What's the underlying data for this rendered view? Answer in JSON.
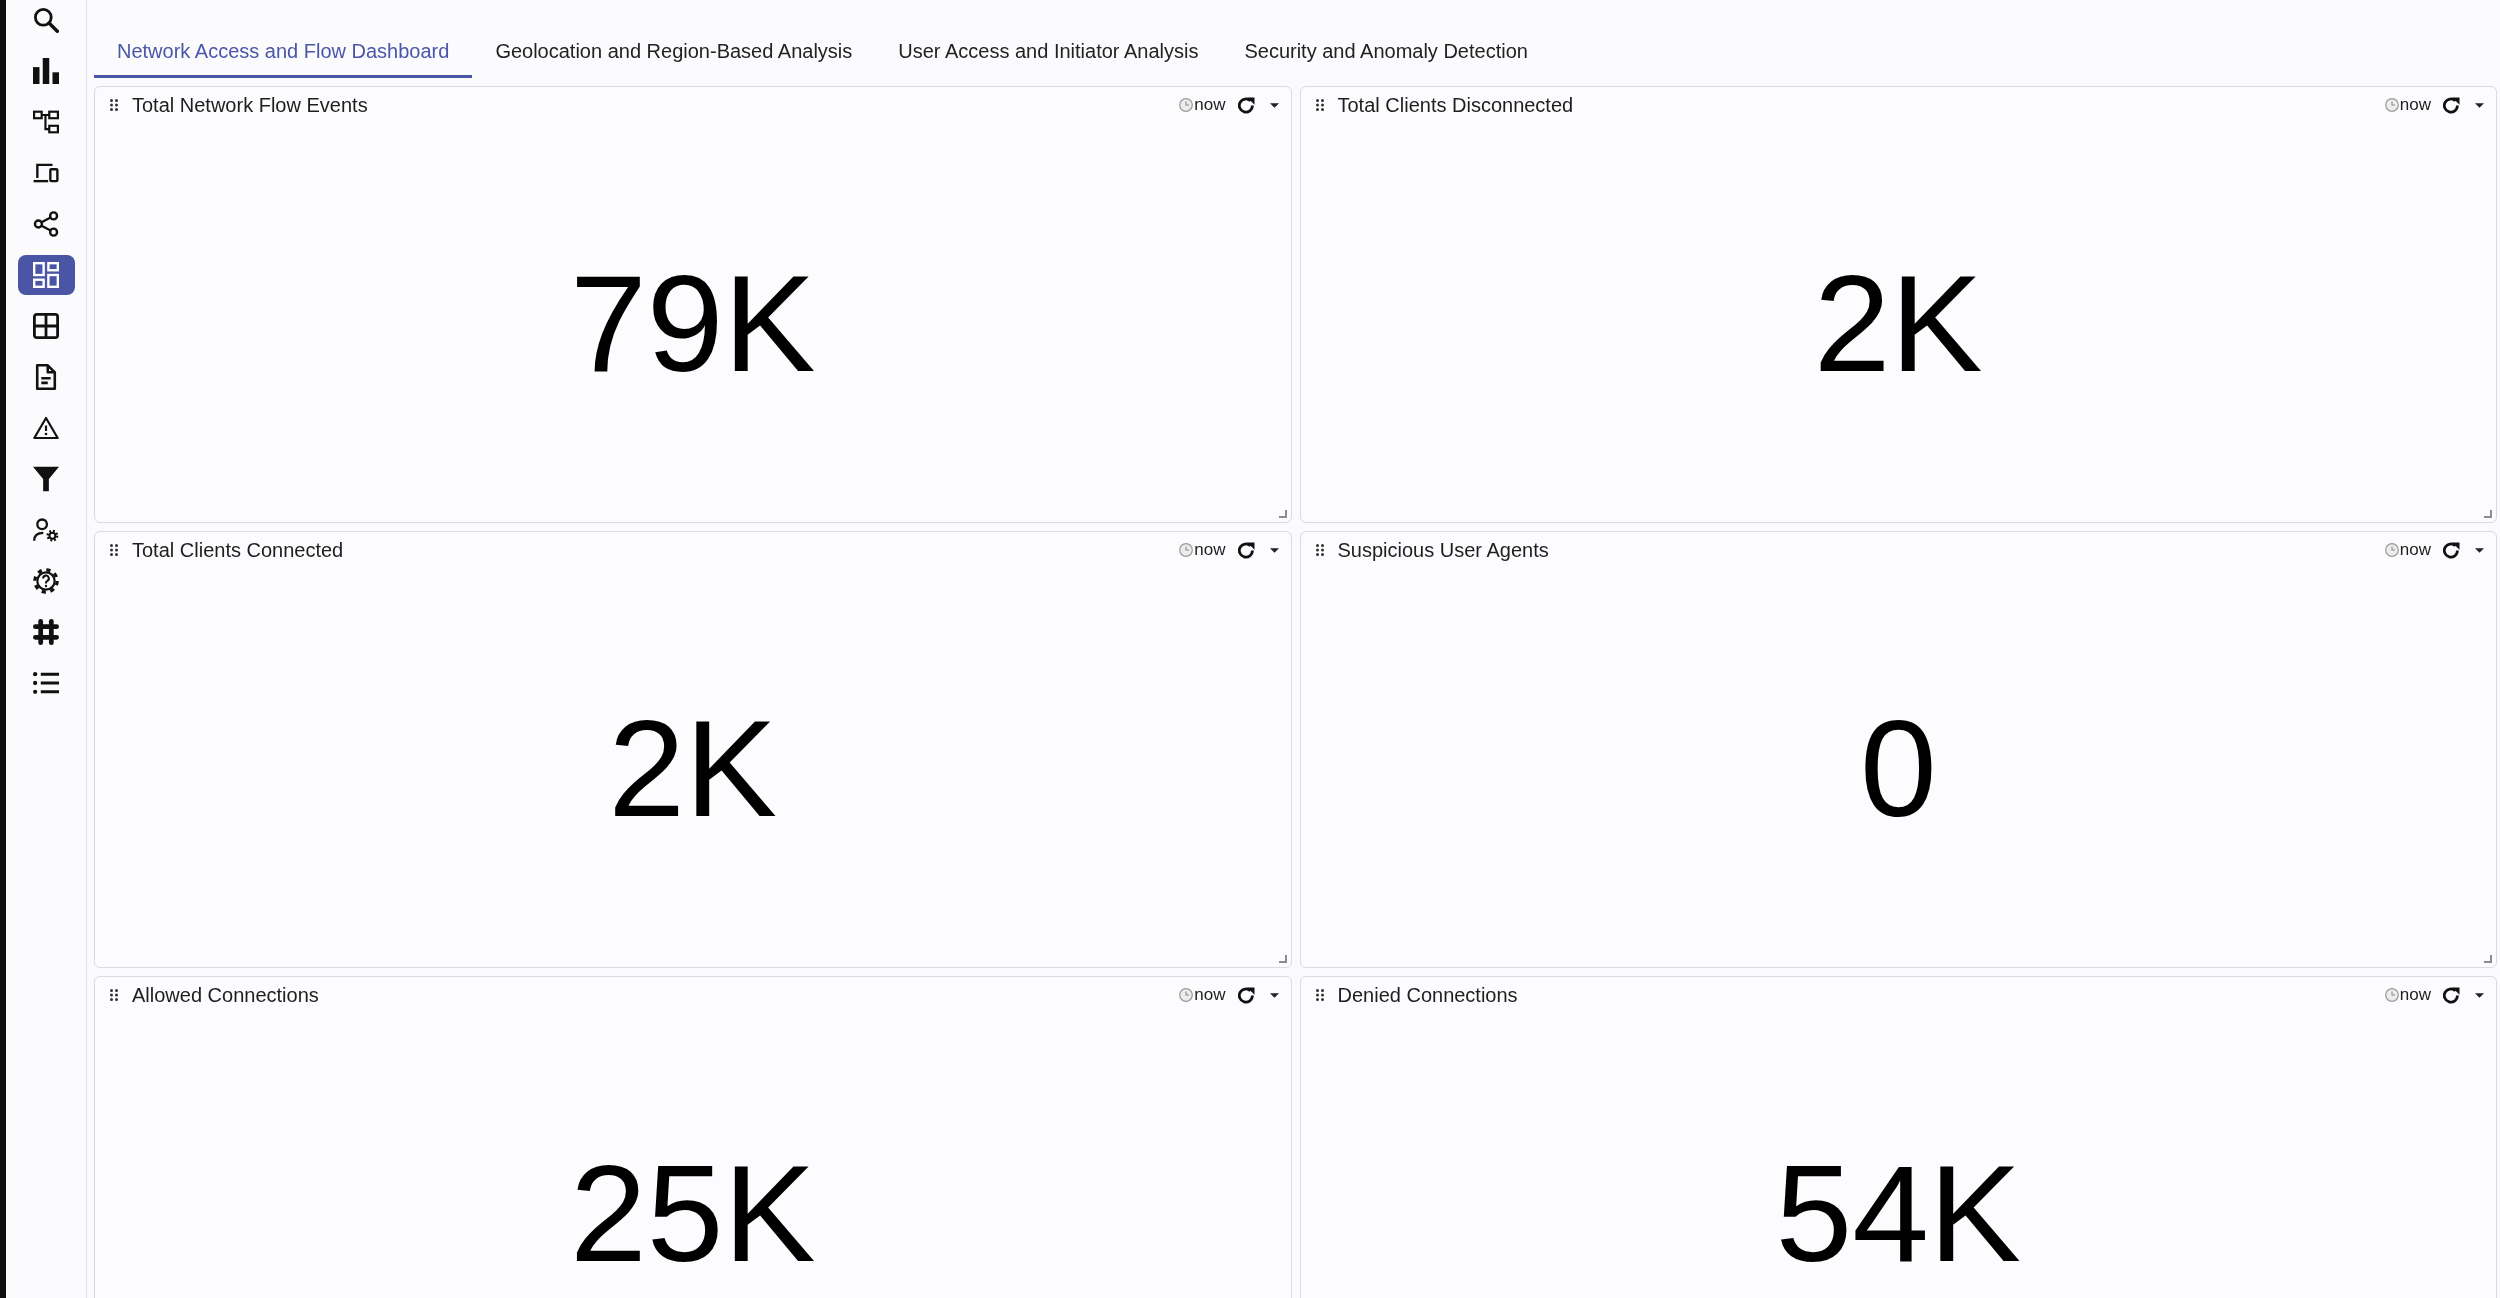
{
  "sidebar": {
    "items": [
      {
        "kind": "search",
        "selected": false
      },
      {
        "kind": "chart",
        "selected": false
      },
      {
        "kind": "hierarchy",
        "selected": false
      },
      {
        "kind": "devices",
        "selected": false
      },
      {
        "kind": "share",
        "selected": false
      },
      {
        "kind": "dashboard",
        "selected": true
      },
      {
        "kind": "table",
        "selected": false
      },
      {
        "kind": "document",
        "selected": false
      },
      {
        "kind": "alert",
        "selected": false
      },
      {
        "kind": "filter",
        "selected": false
      },
      {
        "kind": "admin",
        "selected": false
      },
      {
        "kind": "help",
        "selected": false
      },
      {
        "kind": "integrations",
        "selected": false
      },
      {
        "kind": "list",
        "selected": false
      }
    ]
  },
  "tabs": [
    {
      "label": "Network Access and Flow Dashboard",
      "selected": true
    },
    {
      "label": "Geolocation and Region-Based Analysis",
      "selected": false
    },
    {
      "label": "User Access and Initiator Analysis",
      "selected": false
    },
    {
      "label": "Security and Anomaly Detection",
      "selected": false
    }
  ],
  "panels": [
    {
      "title": "Total Network Flow Events",
      "time": "now",
      "value": "79K"
    },
    {
      "title": "Total Clients Disconnected",
      "time": "now",
      "value": "2K"
    },
    {
      "title": "Total Clients Connected",
      "time": "now",
      "value": "2K"
    },
    {
      "title": "Suspicious User Agents",
      "time": "now",
      "value": "0"
    },
    {
      "title": "Allowed Connections",
      "time": "now",
      "value": "25K"
    },
    {
      "title": "Denied Connections",
      "time": "now",
      "value": "54K"
    }
  ]
}
